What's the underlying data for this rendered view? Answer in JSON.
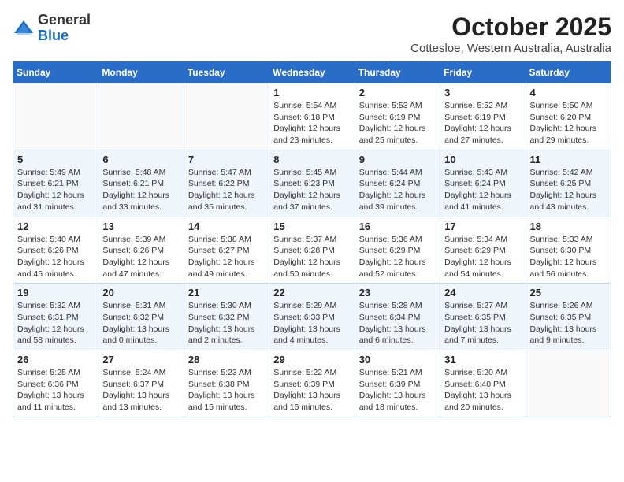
{
  "logo": {
    "general": "General",
    "blue": "Blue"
  },
  "title": "October 2025",
  "subtitle": "Cottesloe, Western Australia, Australia",
  "days_of_week": [
    "Sunday",
    "Monday",
    "Tuesday",
    "Wednesday",
    "Thursday",
    "Friday",
    "Saturday"
  ],
  "weeks": [
    [
      {
        "day": "",
        "info": ""
      },
      {
        "day": "",
        "info": ""
      },
      {
        "day": "",
        "info": ""
      },
      {
        "day": "1",
        "info": "Sunrise: 5:54 AM\nSunset: 6:18 PM\nDaylight: 12 hours\nand 23 minutes."
      },
      {
        "day": "2",
        "info": "Sunrise: 5:53 AM\nSunset: 6:19 PM\nDaylight: 12 hours\nand 25 minutes."
      },
      {
        "day": "3",
        "info": "Sunrise: 5:52 AM\nSunset: 6:19 PM\nDaylight: 12 hours\nand 27 minutes."
      },
      {
        "day": "4",
        "info": "Sunrise: 5:50 AM\nSunset: 6:20 PM\nDaylight: 12 hours\nand 29 minutes."
      }
    ],
    [
      {
        "day": "5",
        "info": "Sunrise: 5:49 AM\nSunset: 6:21 PM\nDaylight: 12 hours\nand 31 minutes."
      },
      {
        "day": "6",
        "info": "Sunrise: 5:48 AM\nSunset: 6:21 PM\nDaylight: 12 hours\nand 33 minutes."
      },
      {
        "day": "7",
        "info": "Sunrise: 5:47 AM\nSunset: 6:22 PM\nDaylight: 12 hours\nand 35 minutes."
      },
      {
        "day": "8",
        "info": "Sunrise: 5:45 AM\nSunset: 6:23 PM\nDaylight: 12 hours\nand 37 minutes."
      },
      {
        "day": "9",
        "info": "Sunrise: 5:44 AM\nSunset: 6:24 PM\nDaylight: 12 hours\nand 39 minutes."
      },
      {
        "day": "10",
        "info": "Sunrise: 5:43 AM\nSunset: 6:24 PM\nDaylight: 12 hours\nand 41 minutes."
      },
      {
        "day": "11",
        "info": "Sunrise: 5:42 AM\nSunset: 6:25 PM\nDaylight: 12 hours\nand 43 minutes."
      }
    ],
    [
      {
        "day": "12",
        "info": "Sunrise: 5:40 AM\nSunset: 6:26 PM\nDaylight: 12 hours\nand 45 minutes."
      },
      {
        "day": "13",
        "info": "Sunrise: 5:39 AM\nSunset: 6:26 PM\nDaylight: 12 hours\nand 47 minutes."
      },
      {
        "day": "14",
        "info": "Sunrise: 5:38 AM\nSunset: 6:27 PM\nDaylight: 12 hours\nand 49 minutes."
      },
      {
        "day": "15",
        "info": "Sunrise: 5:37 AM\nSunset: 6:28 PM\nDaylight: 12 hours\nand 50 minutes."
      },
      {
        "day": "16",
        "info": "Sunrise: 5:36 AM\nSunset: 6:29 PM\nDaylight: 12 hours\nand 52 minutes."
      },
      {
        "day": "17",
        "info": "Sunrise: 5:34 AM\nSunset: 6:29 PM\nDaylight: 12 hours\nand 54 minutes."
      },
      {
        "day": "18",
        "info": "Sunrise: 5:33 AM\nSunset: 6:30 PM\nDaylight: 12 hours\nand 56 minutes."
      }
    ],
    [
      {
        "day": "19",
        "info": "Sunrise: 5:32 AM\nSunset: 6:31 PM\nDaylight: 12 hours\nand 58 minutes."
      },
      {
        "day": "20",
        "info": "Sunrise: 5:31 AM\nSunset: 6:32 PM\nDaylight: 13 hours\nand 0 minutes."
      },
      {
        "day": "21",
        "info": "Sunrise: 5:30 AM\nSunset: 6:32 PM\nDaylight: 13 hours\nand 2 minutes."
      },
      {
        "day": "22",
        "info": "Sunrise: 5:29 AM\nSunset: 6:33 PM\nDaylight: 13 hours\nand 4 minutes."
      },
      {
        "day": "23",
        "info": "Sunrise: 5:28 AM\nSunset: 6:34 PM\nDaylight: 13 hours\nand 6 minutes."
      },
      {
        "day": "24",
        "info": "Sunrise: 5:27 AM\nSunset: 6:35 PM\nDaylight: 13 hours\nand 7 minutes."
      },
      {
        "day": "25",
        "info": "Sunrise: 5:26 AM\nSunset: 6:35 PM\nDaylight: 13 hours\nand 9 minutes."
      }
    ],
    [
      {
        "day": "26",
        "info": "Sunrise: 5:25 AM\nSunset: 6:36 PM\nDaylight: 13 hours\nand 11 minutes."
      },
      {
        "day": "27",
        "info": "Sunrise: 5:24 AM\nSunset: 6:37 PM\nDaylight: 13 hours\nand 13 minutes."
      },
      {
        "day": "28",
        "info": "Sunrise: 5:23 AM\nSunset: 6:38 PM\nDaylight: 13 hours\nand 15 minutes."
      },
      {
        "day": "29",
        "info": "Sunrise: 5:22 AM\nSunset: 6:39 PM\nDaylight: 13 hours\nand 16 minutes."
      },
      {
        "day": "30",
        "info": "Sunrise: 5:21 AM\nSunset: 6:39 PM\nDaylight: 13 hours\nand 18 minutes."
      },
      {
        "day": "31",
        "info": "Sunrise: 5:20 AM\nSunset: 6:40 PM\nDaylight: 13 hours\nand 20 minutes."
      },
      {
        "day": "",
        "info": ""
      }
    ]
  ]
}
